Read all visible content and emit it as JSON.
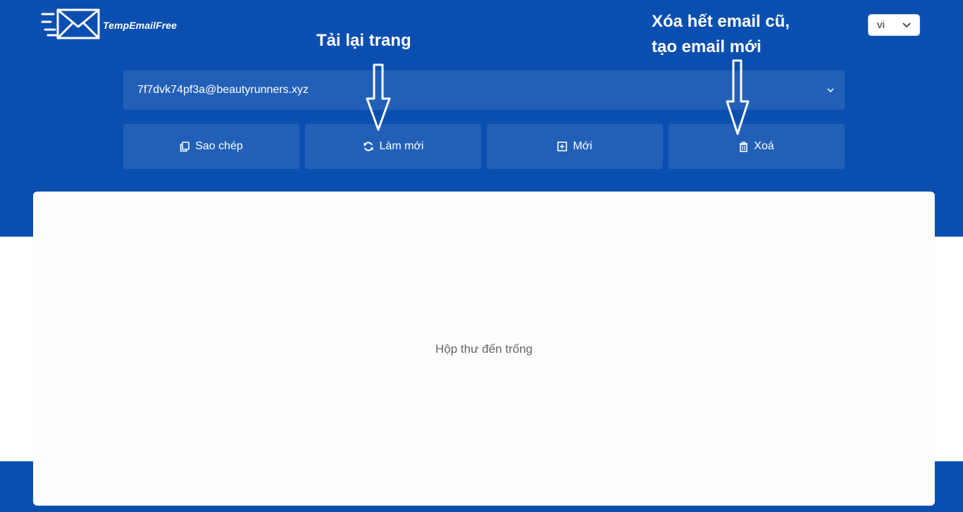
{
  "brand": {
    "name": "TempEmailFree",
    "icon": "envelope-speed-icon"
  },
  "language": {
    "value": "vi",
    "icon": "chevron-down-icon"
  },
  "email": {
    "address": "7f7dvk74pf3a@beautyrunners.xyz",
    "icon": "chevron-down-icon"
  },
  "actions": {
    "copy": {
      "label": "Sao chép",
      "icon": "copy-icon"
    },
    "refresh": {
      "label": "Làm mới",
      "icon": "refresh-icon"
    },
    "new": {
      "label": "Mới",
      "icon": "plus-square-icon"
    },
    "delete": {
      "label": "Xoá",
      "icon": "trash-icon"
    }
  },
  "inbox": {
    "empty_text": "Hộp thư đến trống"
  },
  "annotations": {
    "reload": "Tải lại trang",
    "delete_line1": "Xóa hết email cũ,",
    "delete_line2": "tạo email mới"
  },
  "colors": {
    "primary": "#0a4fb0",
    "panel": "#fdfdfd",
    "text_muted": "#666666"
  }
}
